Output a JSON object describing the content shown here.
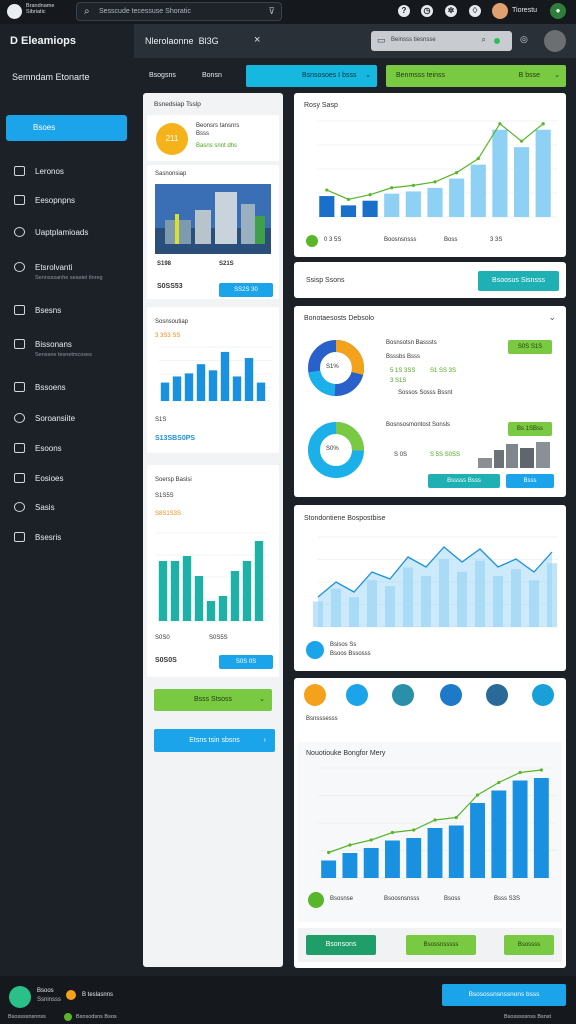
{
  "topbar": {
    "brand": "Brandname Sibriatic",
    "search_text": "Sesscude tecessuse Shoratic",
    "user_name": "Tiorestu"
  },
  "sidebar": {
    "logo": "D Eleamiops",
    "subtitle": "Semndam Etonarte",
    "active_item": "Bsoes",
    "items": [
      {
        "label": "Leronos",
        "sub": ""
      },
      {
        "label": "Eesopnpns",
        "sub": ""
      },
      {
        "label": "Uaptplamioads",
        "sub": ""
      },
      {
        "label": "Etsrolvanti",
        "sub": "Sennsssanhe seastel tlnreg"
      },
      {
        "label": "Bsesns",
        "sub": ""
      },
      {
        "label": "Bissonans",
        "sub": "Senssee tesnetmcoses"
      },
      {
        "label": "Bssoens",
        "sub": ""
      },
      {
        "label": "Soroansiite",
        "sub": ""
      },
      {
        "label": "Esoons",
        "sub": ""
      },
      {
        "label": "Eosioes",
        "sub": ""
      },
      {
        "label": "Sasis",
        "sub": ""
      },
      {
        "label": "Bsesris",
        "sub": ""
      }
    ]
  },
  "header": {
    "title": "Nlerolaonne",
    "tag": "Bl3G",
    "search_text": "Beinsss tiesnsse"
  },
  "toolbar": {
    "tab1": "Bsogsns",
    "tab2": "Bonsn",
    "btn_blue": "Bsnsosoes I bsss",
    "btn_green": "Benmsss teinss",
    "btn_green_right": "B bsse"
  },
  "left": {
    "card1_title": "Bsnedsiap Tsslp",
    "card1_name": "Beonsrs tansnrs",
    "card1_sub": "Bsss",
    "card1_meta": "Basns snnt dhs",
    "badge_num": "211",
    "card2_title": "Sasnonsiap",
    "stat_a": "S198",
    "stat_b": "S21S",
    "price": "S0SS53",
    "pill": "SS2S 30",
    "card3_title": "Sosnsoutiap",
    "card3_val": "3 3S3 SS",
    "card3_num": "S1S",
    "card3_pill": "S13SBS0PS",
    "card4_title": "Soersp Baslsi",
    "card4_val1": "S1S5S",
    "card4_val2": "S8S1S3S",
    "card4_val3": "S0S0",
    "card4_val4": "S0S5S",
    "card4_price": "S0S0S",
    "card4_pill": "S0S 0S",
    "green_btn": "Bsss Stsoss",
    "blue_btn": "Etsns tsin sbsns"
  },
  "right": {
    "chart1_title": "Rosy Sasp",
    "legend1": [
      "0 3 5S",
      "Boosnsnsss",
      "Boss",
      "3 3S"
    ],
    "status_text": "Ssisp Ssons",
    "status_btn": "Bsoosus Sisnsss",
    "donut_title": "Bonotaesosts Debsolo",
    "donut1_title": "Bosnsotsn Basssts",
    "donut1_l1": "Bsssbs Bsss",
    "donut1_l2": "5 1S 3SS",
    "donut1_l3": "3 S1S",
    "donut1_l4": "S1 SS 3S",
    "donut1_l5": "Sossos Sosss Bssnt",
    "donut1_pct": "S1%",
    "donut1_btn": "S0S S1S",
    "donut2_title": "Bosnsosmontost Sonsls",
    "donut2_pct": "S0%",
    "donut2_l1": "S 0S",
    "donut2_l2": "S 5S S0SS",
    "donut2_btn": "Bs 1SBss",
    "donut2_btn2": "Bsssss Bsss",
    "donut2_btn3": "Bsss",
    "chart2_title": "Stondontiene Bospostbise",
    "chart2_foot": "Bsisos Ss",
    "chart2_foot2": "Bsoos Bssosss",
    "avatars_label": "Bsnsssesss",
    "chart3_title": "Nouotiouke Bongfor Mery",
    "legend3": [
      "Bsosnse",
      "Bsoosnsnsss",
      "Bsoss",
      "Bsss S3S"
    ],
    "foot_btn1": "Bsonsons",
    "foot_btn2": "Bsossnsssss",
    "foot_btn3": "Bsossss"
  },
  "footer": {
    "name": "Bsoos",
    "role": "Ssninsss",
    "badge": "B teslasnns",
    "sub1": "Bsossssnsnnss",
    "sub2": "Bsnsodsns Bsos",
    "cta": "Bsosossnsnssnons bsss",
    "right_text": "Bsosssssnss Bsnst"
  },
  "chart_data": [
    {
      "type": "bar",
      "title": "Rosy Sasp",
      "ylabels": [
        "300",
        "300",
        "260",
        "200",
        "100",
        "0"
      ],
      "values": [
        18,
        10,
        14,
        20,
        22,
        25,
        33,
        45,
        75,
        60,
        75
      ]
    },
    {
      "type": "area",
      "title": "Stondontiene Bospostbise",
      "values": [
        30,
        45,
        35,
        55,
        48,
        70,
        60,
        80,
        65,
        78,
        60,
        68,
        55,
        75
      ]
    },
    {
      "type": "bar",
      "title": "Nouotiouke Bongfor Mery",
      "values": [
        14,
        20,
        24,
        30,
        32,
        40,
        42,
        60,
        70,
        78,
        80
      ]
    },
    {
      "type": "bar",
      "title": "Sosnsoutiap",
      "values": [
        30,
        40,
        45,
        60,
        50,
        80,
        40,
        70,
        30
      ]
    },
    {
      "type": "bar",
      "title": "Soersp Baslsi",
      "values": [
        60,
        60,
        65,
        45,
        20,
        25,
        50,
        60,
        80
      ]
    }
  ]
}
